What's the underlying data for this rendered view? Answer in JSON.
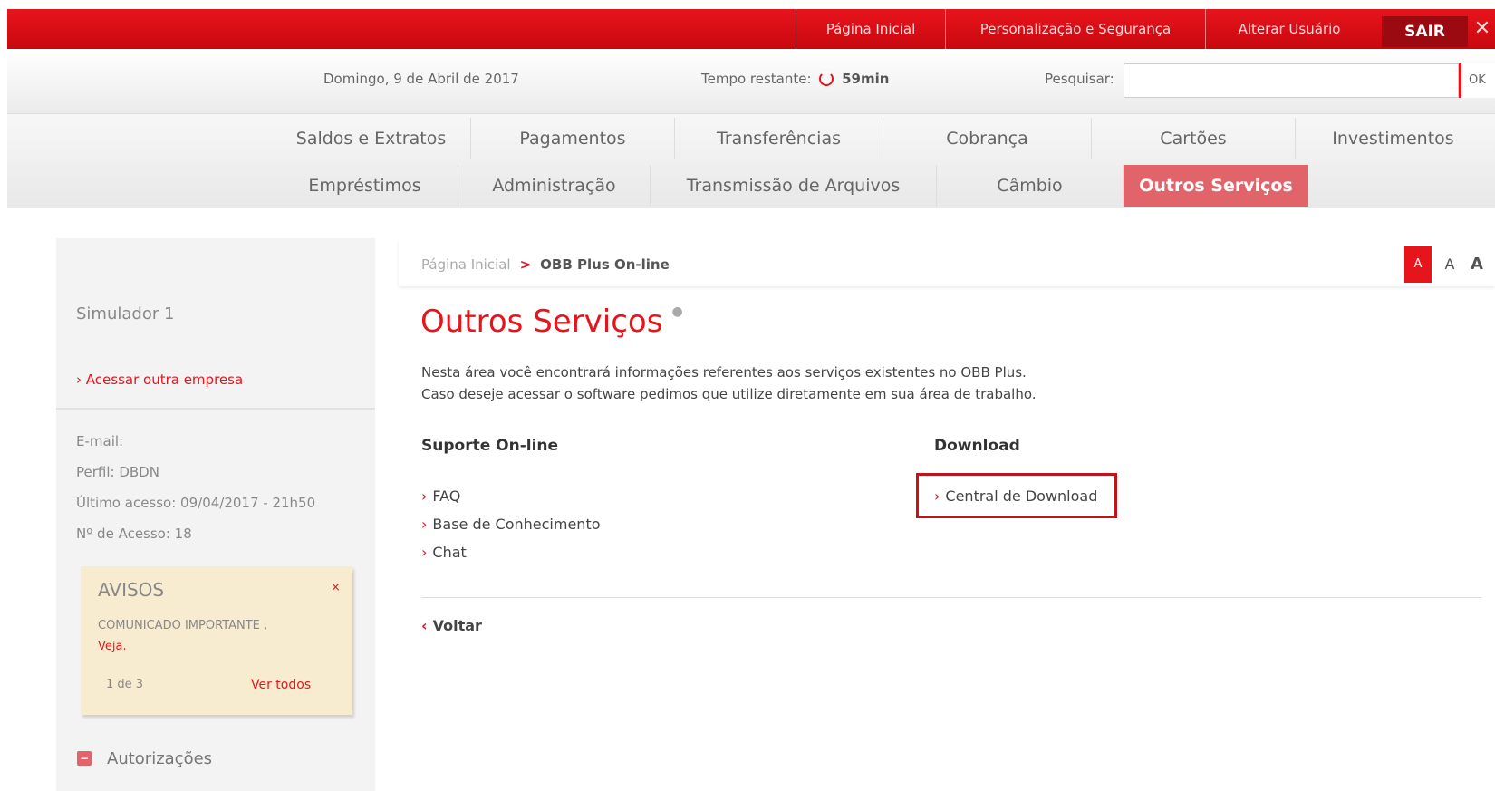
{
  "topbar": {
    "links": [
      "Página Inicial",
      "Personalização e Segurança",
      "Alterar Usuário"
    ],
    "sair": "SAIR",
    "close": "✕"
  },
  "info": {
    "date": "Domingo, 9 de Abril de 2017",
    "time_label": "Tempo restante:",
    "time_value": "59min",
    "search_label": "Pesquisar:",
    "search_value": "",
    "ok": "OK"
  },
  "nav": {
    "row1": [
      "Saldos e Extratos",
      "Pagamentos",
      "Transferências",
      "Cobrança",
      "Cartões",
      "Investimentos"
    ],
    "row2": [
      "Empréstimos",
      "Administração",
      "Transmissão de Arquivos",
      "Câmbio",
      "Outros Serviços"
    ]
  },
  "sidebar": {
    "user": "Simulador 1",
    "switch_link": "Acessar outra empresa",
    "email": "E-mail:",
    "perfil": "Perfil: DBDN",
    "ultimo": "Último acesso: 09/04/2017 - 21h50",
    "acessos": "Nº de Acesso: 18",
    "avisos": {
      "title": "AVISOS",
      "close": "×",
      "message": "COMUNICADO IMPORTANTE ,",
      "link": "Veja.",
      "page": "1 de 3",
      "all": "Ver todos"
    },
    "autorizacoes": "Autorizações"
  },
  "breadcrumb": {
    "home": "Página Inicial",
    "sep": ">",
    "current": "OBB Plus On-line",
    "font_sizes": [
      "A",
      "A",
      "A"
    ]
  },
  "main": {
    "title": "Outros Serviços",
    "desc1": "Nesta área você encontrará informações referentes aos serviços existentes no OBB Plus.",
    "desc2": "Caso deseje acessar o software pedimos que utilize diretamente em sua área de trabalho.",
    "suporte": {
      "title": "Suporte On-line",
      "links": [
        "FAQ",
        "Base de Conhecimento",
        "Chat"
      ]
    },
    "download": {
      "title": "Download",
      "links": [
        "Central de Download"
      ]
    },
    "back": "Voltar"
  },
  "colors": {
    "brand_red": "#e8141c",
    "active_nav": "#e06469",
    "highlight_box": "#c8101a"
  }
}
